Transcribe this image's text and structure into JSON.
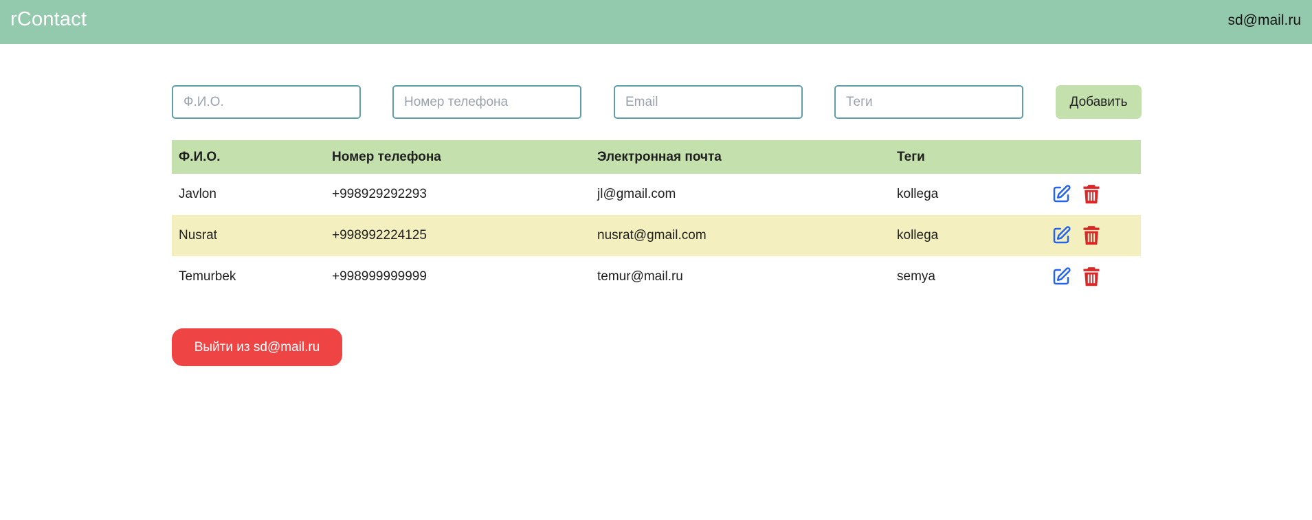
{
  "header": {
    "brand": "rContact",
    "user_email": "sd@mail.ru"
  },
  "form": {
    "fio_placeholder": "Ф.И.О.",
    "phone_placeholder": "Номер телефона",
    "email_placeholder": "Email",
    "tags_placeholder": "Теги",
    "add_label": "Добавить"
  },
  "table": {
    "columns": [
      "Ф.И.О.",
      "Номер телефона",
      "Электронная почта",
      "Теги"
    ],
    "rows": [
      {
        "name": "Javlon",
        "phone": "+998929292293",
        "email": "jl@gmail.com",
        "tags": "kollega"
      },
      {
        "name": "Nusrat",
        "phone": "+998992224125",
        "email": "nusrat@gmail.com",
        "tags": "kollega"
      },
      {
        "name": "Temurbek",
        "phone": "+998999999999",
        "email": "temur@mail.ru",
        "tags": "semya"
      }
    ]
  },
  "actions": {
    "edit_icon": "edit-icon",
    "delete_icon": "trash-icon",
    "edit_color": "#2563eb",
    "delete_color": "#dc2626"
  },
  "logout": {
    "label": "Выйти из sd@mail.ru"
  },
  "colors": {
    "topbar": "#93c9ad",
    "accent": "#c4e0ac",
    "row_alt": "#f4efbe",
    "danger": "#ef4444"
  }
}
